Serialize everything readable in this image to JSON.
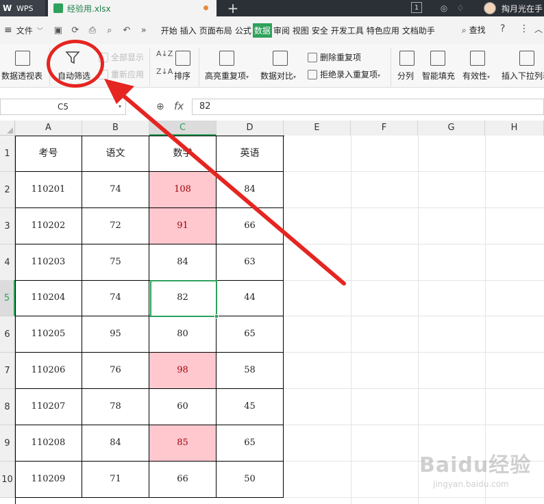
{
  "titlebar": {
    "app_name": "WPS",
    "file_tab": "经验用.xlsx",
    "new_tab": "+",
    "badge": "1",
    "username": "掏月光在手"
  },
  "menubar": {
    "file": "文件",
    "tabs": [
      "开始",
      "插入",
      "页面布局",
      "公式",
      "数据",
      "审阅",
      "视图",
      "安全",
      "开发工具",
      "特色应用",
      "文档助手"
    ],
    "active_tab": "数据",
    "search": "查找",
    "help": "?",
    "more": "⋮"
  },
  "ribbon": {
    "pivot": "数据透视表",
    "autofilter": "自动筛选",
    "show_all": "全部显示",
    "reapply": "重新应用",
    "sort": "排序",
    "highlight_dup": "高亮重复项",
    "compare": "数据对比",
    "remove_dup": "删除重复项",
    "reject_dup": "拒绝录入重复项",
    "split": "分列",
    "smart_fill": "智能填充",
    "validity": "有效性",
    "dropdown_list": "插入下拉列表"
  },
  "formula": {
    "cell_ref": "C5",
    "fx": "fx",
    "value": "82"
  },
  "grid": {
    "columns": [
      "A",
      "B",
      "C",
      "D",
      "E",
      "F",
      "G",
      "H"
    ],
    "rows": [
      "1",
      "2",
      "3",
      "4",
      "5",
      "6",
      "7",
      "8",
      "9",
      "10"
    ],
    "selected_col": "C",
    "selected_row": "5",
    "headers": [
      "考号",
      "语文",
      "数学",
      "英语"
    ],
    "data": [
      [
        "110201",
        "74",
        "108",
        "84"
      ],
      [
        "110202",
        "72",
        "91",
        "66"
      ],
      [
        "110203",
        "75",
        "84",
        "63"
      ],
      [
        "110204",
        "74",
        "82",
        "44"
      ],
      [
        "110205",
        "95",
        "80",
        "65"
      ],
      [
        "110206",
        "76",
        "98",
        "58"
      ],
      [
        "110207",
        "78",
        "60",
        "45"
      ],
      [
        "110208",
        "84",
        "85",
        "65"
      ],
      [
        "110209",
        "71",
        "66",
        "50"
      ]
    ],
    "highlighted_rows_col_c": [
      0,
      1,
      5,
      7
    ]
  },
  "watermark": {
    "text": "Baidu经验",
    "url": "jingyan.baidu.com"
  },
  "colors": {
    "accent": "#2ea15c",
    "highlight_fill": "#ffc7ce",
    "highlight_text": "#9c0006",
    "annotation_red": "#e52521"
  }
}
